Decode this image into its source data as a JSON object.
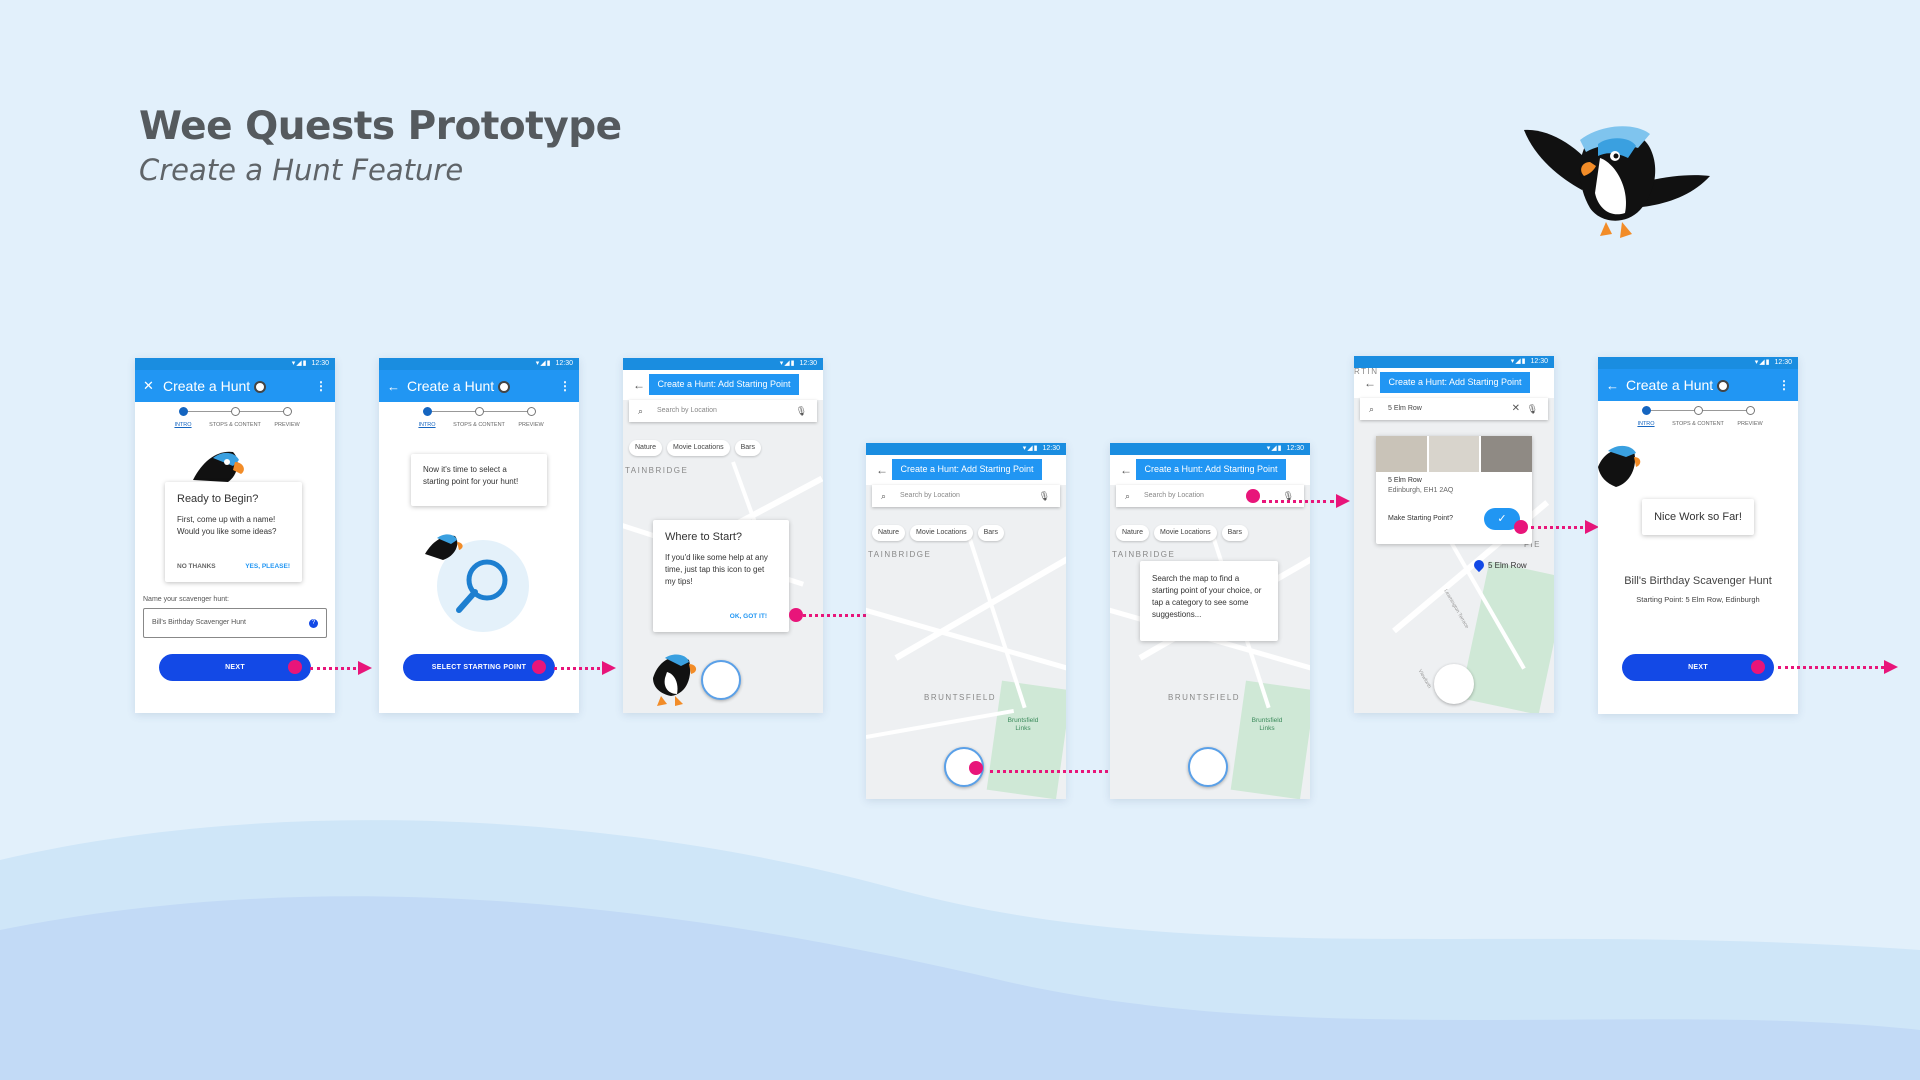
{
  "header": {
    "title": "Wee Quests Prototype",
    "subtitle": "Create a Hunt Feature"
  },
  "colors": {
    "background": "#e2f0fb",
    "primary": "#2196f3",
    "button": "#1349e6",
    "hotspot": "#e8157a"
  },
  "status": {
    "time": "12:30"
  },
  "stepper": {
    "steps": [
      "INTRO",
      "STOPS & CONTENT",
      "PREVIEW"
    ]
  },
  "screen1": {
    "title": "Create a Hunt",
    "card_title": "Ready to Begin?",
    "card_body": "First, come up with a name! Would you like some ideas?",
    "no_thanks": "NO THANKS",
    "yes_please": "YES, PLEASE!",
    "field_label": "Name your scavenger hunt:",
    "field_value": "Bill's Birthday Scavenger Hunt",
    "next": "NEXT"
  },
  "screen2": {
    "title": "Create a Hunt",
    "tip": "Now it's time to select a starting point for your hunt!",
    "button": "SELECT STARTING POINT"
  },
  "screen3": {
    "bar_title": "Create a Hunt: Add Starting Point",
    "search_placeholder": "Search by Location",
    "chips": [
      "Nature",
      "Movie Locations",
      "Bars"
    ],
    "map_label": "TAINBRIDGE",
    "card_title": "Where to Start?",
    "card_body": "If you'd like some help at any time, just tap this icon to get my tips!",
    "ok": "OK, GOT IT!"
  },
  "screen4": {
    "bar_title": "Create a Hunt: Add Starting Point",
    "search_placeholder": "Search by Location",
    "chips": [
      "Nature",
      "Movie Locations",
      "Bars"
    ],
    "map_label1": "TAINBRIDGE",
    "map_label2": "BRUNTSFIELD",
    "park_label": "Bruntsfield Links"
  },
  "screen5": {
    "bar_title": "Create a Hunt: Add Starting Point",
    "search_placeholder": "Search by Location",
    "chips": [
      "Nature",
      "Movie Locations",
      "Bars"
    ],
    "map_label1": "TAINBRIDGE",
    "map_label2": "BRUNTSFIELD",
    "park_label": "Bruntsfield Links",
    "card_body": "Search the map to find a starting point of your choice, or tap a category to see some suggestions..."
  },
  "screen6": {
    "bar_title": "Create a Hunt: Add Starting Point",
    "search_value": "5 Elm Row",
    "place_name": "5 Elm Row",
    "place_address": "Edinburgh, EH1 2AQ",
    "make_start": "Make Starting Point?",
    "pin_label": "5 Elm Row",
    "map_label1": "RTIN",
    "map_label2": "FIE",
    "street1": "Leamington Terrace",
    "street2": "Viewforth"
  },
  "screen7": {
    "title": "Create a Hunt",
    "bubble": "Nice Work so Far!",
    "hunt_name": "Bill's Birthday Scavenger Hunt",
    "starting_point": "Starting Point: 5 Elm Row, Edinburgh",
    "next": "NEXT"
  }
}
